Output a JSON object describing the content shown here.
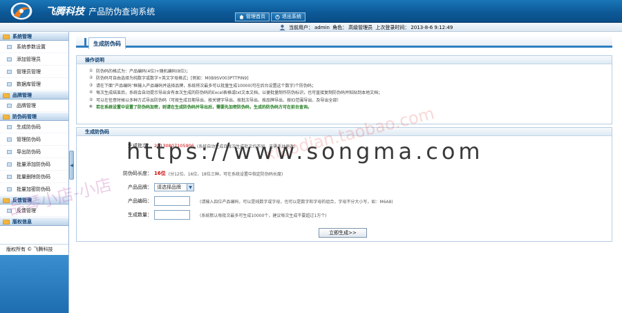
{
  "header": {
    "company": "飞腾科技",
    "system_name": "产品防伪查询系统",
    "nav": [
      {
        "label": "管理首页",
        "icon": "home-icon"
      },
      {
        "label": "退出系统",
        "icon": "logout-icon"
      }
    ]
  },
  "infobar": {
    "user_label": "当前用户：",
    "user": "admin",
    "role_label": "角色：",
    "role": "高级管理员",
    "last_login_label": "上次登录时间：",
    "last_login": "2013-8-6 9:12:49"
  },
  "sidebar": {
    "groups": [
      {
        "title": "系统管理",
        "items": [
          "系统参数设置",
          "添加管理员",
          "管理员管理",
          "数据库管理"
        ]
      },
      {
        "title": "品牌管理",
        "items": [
          "品牌管理"
        ]
      },
      {
        "title": "防伪码管理",
        "items": [
          "生成防伪码",
          "管理防伪码",
          "导出防伪码",
          "批量添加防伪码",
          "批量删除防伪码",
          "批量加密防伪码"
        ]
      },
      {
        "title": "反馈管理",
        "items": [
          "反馈管理"
        ]
      },
      {
        "title": "版权信息",
        "items": []
      }
    ],
    "copyright": "版权所有 © 飞腾科技"
  },
  "main": {
    "title": "生成防伪码",
    "notes_title": "操作说明",
    "notes": [
      {
        "num": "①",
        "text": "防伪码的格式为：产品编码(4位)+随机编码(8位)；",
        "warn": false
      },
      {
        "num": "②",
        "text": "防伪码可自由选择为纯数字或数字+英文字母格式；[例如：M0B9SV003PTTPIN9]",
        "warn": false
      },
      {
        "num": "③",
        "text": "请在下面“产品编码”框输入产品编码并选择品牌，系统将次最多可以批量生成10000(可在后台设置这个数字)个防伪码；",
        "warn": false
      },
      {
        "num": "④",
        "text": "每次生成结束后，系统会自动提示导出含有本次生成的防伪码的Excel表格或txt文本文档，以便批量制作防伪标识，也可直接复制防伪码并粘贴到本地文档；",
        "warn": false
      },
      {
        "num": "⑤",
        "text": "可以在任意时候以多种方式导出防伪码（可按生成日期导出、按关键字导出、按批次导出、按品牌导出、按ID范围导出、及导出全部）",
        "warn": false
      },
      {
        "num": "⑥",
        "text": "若在系统设置中设置了防伪码加密，则请在生成防伪码并导出后，需要先加密防伪码，生成的防伪码方可在前台查询。",
        "warn": true
      }
    ],
    "form_title": "生成防伪码",
    "form": {
      "batch_label": "生成批次：",
      "batch_value": "20130807105906",
      "batch_hint": "(系统自动生成且每次生成批次均不同，无需手动更改)",
      "length_label": "防伪码长度：",
      "length_value": "16位",
      "length_hint": "(分12位、16位、18位三种，可在系统设置中指定防伪码长度)",
      "brand_label": "产品品牌：",
      "brand_select": "请选择品牌",
      "code_label": "产品编码：",
      "code_hint": "(请输入四位产品编码，可以是纯数字或字母，也可以是数字和字母的组合，字母不分大小写，如：M6A8)",
      "qty_label": "生成数量：",
      "qty_hint": "(系统默认每批次最多可生成10000个，建议每次生成不要超过1万个)",
      "submit_label": "立即生成>>"
    }
  },
  "watermarks": {
    "url": "https://www.songma.com",
    "shop": "xiaodian.taobao.com",
    "shop2": "品琴小店-小店"
  }
}
